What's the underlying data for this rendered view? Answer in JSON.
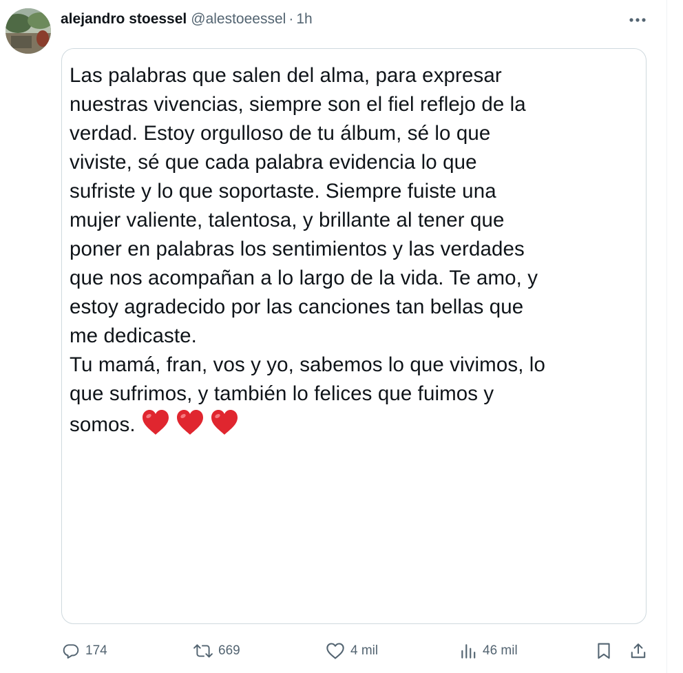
{
  "tweet": {
    "author_name": "alejandro stoessel",
    "author_handle": "@alestoeessel",
    "separator": "·",
    "timestamp": "1h",
    "text_lines": [
      "Las palabras que salen del alma, para expresar",
      "nuestras vivencias, siempre son el fiel reflejo de la",
      "verdad. Estoy orgulloso de tu álbum, sé lo que",
      "viviste, sé que cada palabra evidencia lo que",
      "sufriste y lo que soportaste. Siempre fuiste una",
      "mujer valiente, talentosa, y brillante al tener que",
      "poner en palabras los sentimientos y las verdades",
      "que nos acompañan a lo largo de la vida. Te amo, y",
      "estoy agradecido por las canciones tan bellas que",
      "me dedicaste.",
      "Tu mamá, fran, vos y yo, sabemos lo que vivimos, lo",
      "que sufrimos, y también lo felices que fuimos y",
      "somos."
    ],
    "emojis": [
      "heart-emoji",
      "heart-emoji",
      "heart-emoji"
    ]
  },
  "actions": {
    "replies": "174",
    "reposts": "669",
    "likes": "4 mil",
    "views": "46 mil"
  },
  "icons": {
    "more": "more-horizontal-icon",
    "reply": "reply-icon",
    "repost": "repost-icon",
    "like": "like-icon",
    "views": "views-icon",
    "bookmark": "bookmark-icon",
    "share": "share-icon"
  },
  "colors": {
    "text": "#0f1419",
    "secondary": "#536471",
    "border": "#cfd9de",
    "heart": "#e0262f"
  }
}
